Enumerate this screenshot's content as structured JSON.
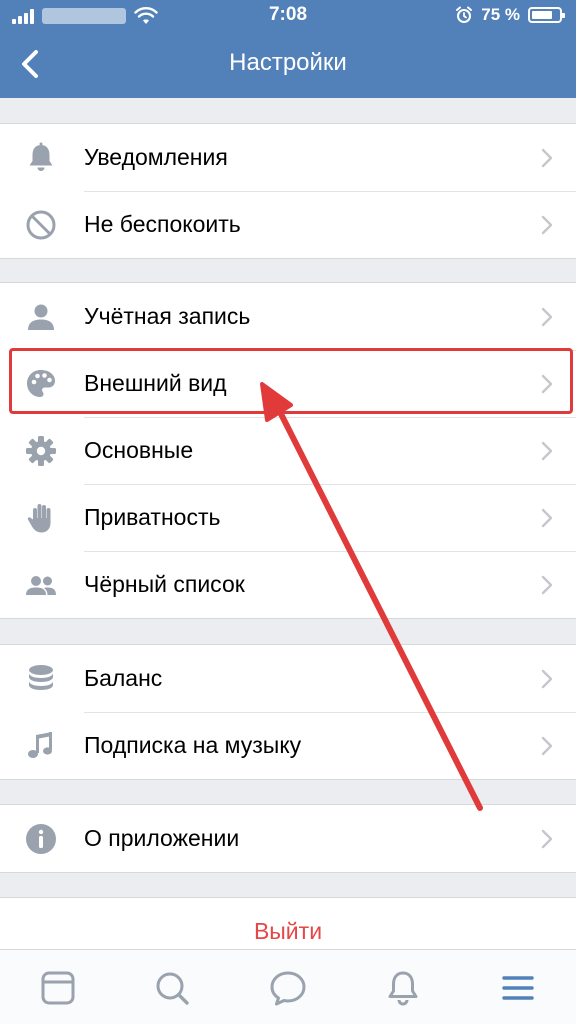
{
  "status_bar": {
    "time": "7:08",
    "battery": "75 %",
    "battery_level": 0.75
  },
  "nav": {
    "title": "Настройки"
  },
  "sections": [
    {
      "items": [
        {
          "label": "Уведомления",
          "icon": "bell-icon"
        },
        {
          "label": "Не беспокоить",
          "icon": "do-not-disturb-icon"
        }
      ]
    },
    {
      "items": [
        {
          "label": "Учётная запись",
          "icon": "user-icon"
        },
        {
          "label": "Внешний вид",
          "icon": "palette-icon"
        },
        {
          "label": "Основные",
          "icon": "gear-icon"
        },
        {
          "label": "Приватность",
          "icon": "hand-icon"
        },
        {
          "label": "Чёрный список",
          "icon": "users-icon"
        }
      ]
    },
    {
      "items": [
        {
          "label": "Баланс",
          "icon": "coins-icon"
        },
        {
          "label": "Подписка на музыку",
          "icon": "music-note-icon"
        }
      ]
    },
    {
      "items": [
        {
          "label": "О приложении",
          "icon": "info-icon"
        }
      ]
    }
  ],
  "logout": {
    "label": "Выйти"
  },
  "tabbar": {
    "tabs": [
      {
        "icon": "news-icon"
      },
      {
        "icon": "search-icon"
      },
      {
        "icon": "messages-icon"
      },
      {
        "icon": "notifications-icon"
      },
      {
        "icon": "menu-icon"
      }
    ]
  },
  "colors": {
    "header": "#5181b8",
    "icon_gray": "#99a2ad",
    "chevron": "#c4c8cc",
    "logout_red": "#e64646",
    "annotation_red": "#e03a3a"
  }
}
